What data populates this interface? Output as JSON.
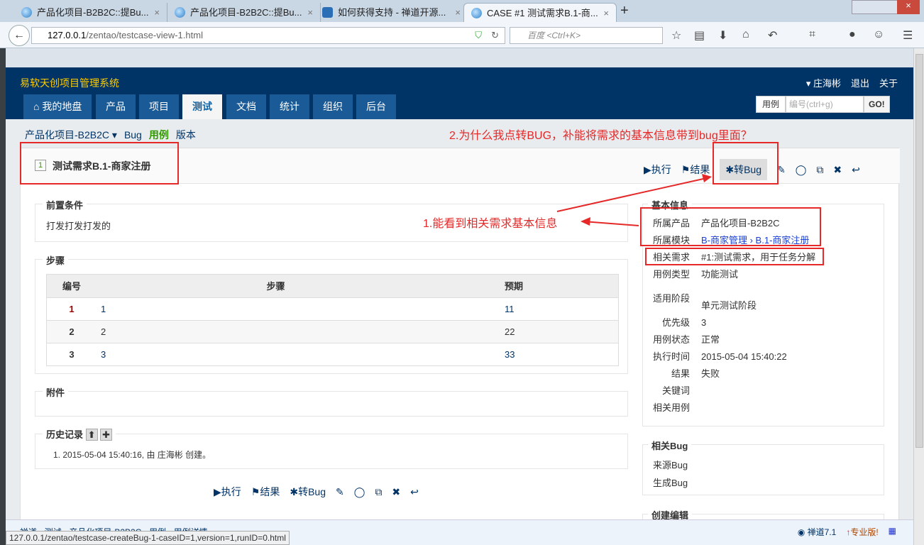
{
  "browser": {
    "tabs": [
      {
        "label": "产品化项目-B2B2C::提Bu..."
      },
      {
        "label": "产品化项目-B2B2C::提Bu..."
      },
      {
        "label": "如何获得支持 - 禅道开源..."
      },
      {
        "label": "CASE #1 测试需求B.1-商..."
      }
    ],
    "new_tab": "+",
    "url_host": "127.0.0.1",
    "url_path": "/zentao/testcase-view-1.html",
    "search_placeholder": "百度 <Ctrl+K>",
    "status_url": "127.0.0.1/zentao/testcase-createBug-1-caseID=1,version=1,runID=0.html"
  },
  "app": {
    "title": "易软天创项目管理系统",
    "user": "▾ 庄海彬",
    "logout": "退出",
    "about": "关于",
    "nav": [
      "我的地盘",
      "产品",
      "项目",
      "测试",
      "文档",
      "统计",
      "组织",
      "后台"
    ],
    "search": {
      "type": "用例",
      "placeholder": "编号(ctrl+g)",
      "go": "GO!"
    }
  },
  "subnav": {
    "product": "产品化项目-B2B2C ▾",
    "items": [
      "Bug",
      "用例",
      "版本"
    ]
  },
  "annotations": {
    "q2": "2.为什么我点转BUG，补能将需求的基本信息带到bug里面？",
    "q1": "1.能看到相关需求基本信息"
  },
  "case": {
    "id": "1",
    "title": "测试需求B.1-商家注册",
    "actions": {
      "run": "执行",
      "result": "结果",
      "tobug": "转Bug"
    },
    "precondition": {
      "label": "前置条件",
      "text": "打发打发打发的"
    },
    "steps": {
      "label": "步骤",
      "headers": [
        "编号",
        "步骤",
        "预期"
      ],
      "rows": [
        [
          "1",
          "1",
          "11"
        ],
        [
          "2",
          "2",
          "22"
        ],
        [
          "3",
          "3",
          "33"
        ]
      ]
    },
    "files": {
      "label": "附件"
    },
    "history": {
      "label": "历史记录",
      "items": [
        "1. 2015-05-04 15:40:16, 由 庄海彬 创建。"
      ]
    }
  },
  "basic": {
    "label": "基本信息",
    "rows": [
      {
        "k": "所属产品",
        "v": "产品化项目-B2B2C"
      },
      {
        "k": "所属模块",
        "v": "B-商家管理 › B.1-商家注册"
      },
      {
        "k": "相关需求",
        "v": "#1:测试需求，用于任务分解"
      },
      {
        "k": "用例类型",
        "v": "功能测试"
      },
      {
        "k": "适用阶段",
        "v": "单元测试阶段"
      },
      {
        "k": "优先级",
        "v": "3"
      },
      {
        "k": "用例状态",
        "v": "正常"
      },
      {
        "k": "执行时间",
        "v": "2015-05-04 15:40:22"
      },
      {
        "k": "结果",
        "v": "失败"
      },
      {
        "k": "关键词",
        "v": ""
      },
      {
        "k": "相关用例",
        "v": ""
      }
    ]
  },
  "related_bug": {
    "label": "相关Bug",
    "rows": [
      "来源Bug",
      "生成Bug"
    ]
  },
  "create_edit": {
    "label": "创建编辑"
  },
  "footer": {
    "breadcrumb": "禅道 › 测试 › 产品化项目-B2B2C › 用例 › 用例详情",
    "version": "禅道7.1",
    "pro": "专业版!"
  }
}
